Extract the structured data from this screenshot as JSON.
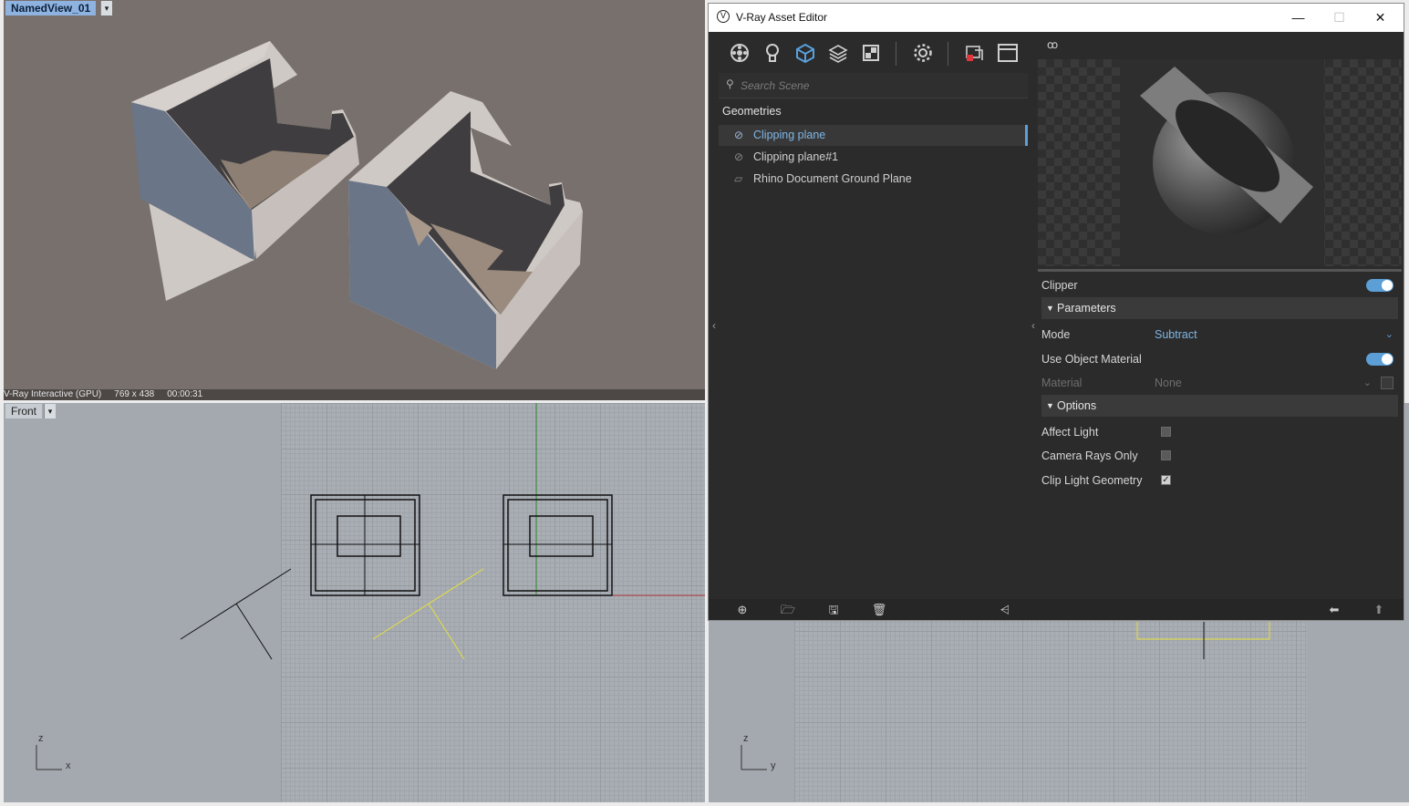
{
  "viewports": {
    "render": {
      "title": "NamedView_01",
      "status": {
        "renderer": "V-Ray Interactive (GPU)",
        "resolution": "769 x 438",
        "time": "00:00:31"
      }
    },
    "front": {
      "title": "Front",
      "axis_vertical": "z",
      "axis_horizontal": "x"
    },
    "right": {
      "axis_vertical": "z",
      "axis_horizontal": "y"
    }
  },
  "editor": {
    "title": "V-Ray Asset Editor",
    "window_buttons": {
      "minimize": "—",
      "maximize": "☐",
      "close": "✕"
    },
    "toolbar": [
      "materials-icon",
      "lights-icon",
      "geometry-icon",
      "textures-icon",
      "render-elements-icon",
      "settings-icon",
      "interactive-render-icon",
      "frame-buffer-icon"
    ],
    "search": {
      "placeholder": "Search Scene",
      "value": ""
    },
    "sidebar": {
      "section": "Geometries",
      "items": [
        {
          "label": "Clipping plane",
          "selected": true,
          "icon": "clipper-icon"
        },
        {
          "label": "Clipping plane#1",
          "selected": false,
          "icon": "clipper-icon"
        },
        {
          "label": "Rhino Document Ground Plane",
          "selected": false,
          "icon": "plane-icon"
        }
      ]
    },
    "properties": {
      "asset_name": "Clipper",
      "asset_enabled": true,
      "groups": {
        "parameters": "Parameters",
        "options": "Options"
      },
      "mode_label": "Mode",
      "mode_value": "Subtract",
      "use_object_material_label": "Use Object Material",
      "use_object_material": true,
      "material_label": "Material",
      "material_value": "None",
      "affect_light_label": "Affect Light",
      "affect_light": false,
      "camera_rays_only_label": "Camera Rays Only",
      "camera_rays_only": false,
      "clip_light_geometry_label": "Clip Light Geometry",
      "clip_light_geometry": true
    },
    "accent_color": "#5aa0dc"
  }
}
